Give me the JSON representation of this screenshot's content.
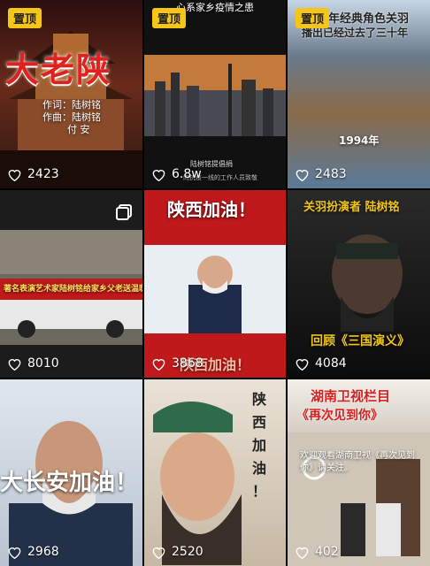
{
  "pin_label": "置顶",
  "tiles": [
    {
      "likes": "2423",
      "pinned": true,
      "title": "大老陕",
      "credits": [
        "作词：陆树铭",
        "作曲：陆树铭",
        "付 安"
      ]
    },
    {
      "likes": "6.8w",
      "pinned": true,
      "top_caption": "心系家乡疫情之患",
      "caption": "陆树铭提倡捐",
      "caption2": "向抗疫一线的工作人员致敬"
    },
    {
      "likes": "2483",
      "pinned": true,
      "headline1": "年经典角色关羽",
      "headline2": "播出已经过去了三十年",
      "year": "1994年"
    },
    {
      "likes": "8010",
      "banner": "著名表演艺术家陆树铭给家乡父老送温暖"
    },
    {
      "likes": "3868",
      "headline": "陕西加油！",
      "footer": "陕西加油！"
    },
    {
      "likes": "4084",
      "headline": "关羽扮演者 陆树铭",
      "footer": "回顾《三国演义》"
    },
    {
      "likes": "2968",
      "text": "大长安加油！"
    },
    {
      "likes": "2520",
      "vertical_text": [
        "陕",
        "西",
        "加",
        "油",
        "！"
      ]
    },
    {
      "likes": "402",
      "headline1": "湖南卫视栏目",
      "headline2": "《再次见到你》",
      "caption": "欢迎观看湖南卫视《再次见到你》请关注。"
    }
  ],
  "colors": {
    "pin": "#f5c518",
    "red": "#d32020",
    "gold": "#f0c419"
  }
}
